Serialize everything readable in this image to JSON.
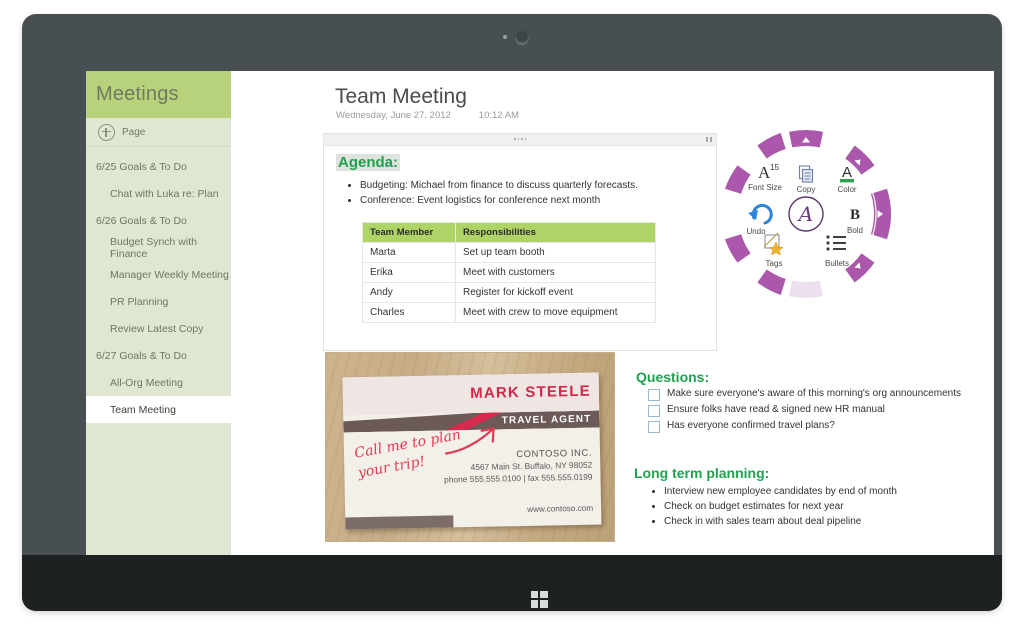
{
  "device": {
    "camera_icon": "camera-dot",
    "home_button_icon": "windows-logo-icon"
  },
  "sidebar": {
    "header_title": "Meetings",
    "new_page_label": "Page",
    "new_page_icon": "plus-circle-icon",
    "items": [
      {
        "label": "6/25 Goals & To Do",
        "level": 0,
        "selected": false
      },
      {
        "label": "Chat with Luka re: Plan",
        "level": 1,
        "selected": false
      },
      {
        "label": "6/26 Goals & To Do",
        "level": 0,
        "selected": false
      },
      {
        "label": "Budget Synch with Finance",
        "level": 1,
        "selected": false
      },
      {
        "label": "Manager Weekly Meeting",
        "level": 1,
        "selected": false
      },
      {
        "label": "PR Planning",
        "level": 1,
        "selected": false
      },
      {
        "label": "Review Latest Copy",
        "level": 1,
        "selected": false
      },
      {
        "label": "6/27 Goals & To Do",
        "level": 0,
        "selected": false
      },
      {
        "label": "All-Org Meeting",
        "level": 1,
        "selected": false
      },
      {
        "label": "Team Meeting",
        "level": 1,
        "selected": true
      }
    ]
  },
  "page": {
    "title": "Team Meeting",
    "date": "Wednesday, June 27, 2012",
    "time": "10:12 AM"
  },
  "agenda": {
    "heading": "Agenda:",
    "bullets": [
      "Budgeting:  Michael from finance to discuss quarterly forecasts.",
      "Conference: Event logistics for conference next month"
    ],
    "table": {
      "columns": [
        "Team Member",
        "Responsibilities"
      ],
      "rows": [
        [
          "Marta",
          "Set up team booth"
        ],
        [
          "Erika",
          "Meet with customers"
        ],
        [
          "Andy",
          "Register for kickoff event"
        ],
        [
          "Charles",
          "Meet with crew to move equipment"
        ]
      ]
    }
  },
  "radial_menu": {
    "center_label": "A",
    "center_icon": "onenote-a-icon",
    "ring_color": "#a855a8",
    "ring_color_light": "#ede2ef",
    "items": [
      {
        "label": "Copy",
        "icon": "copy-icon"
      },
      {
        "label": "Color",
        "icon": "font-color-icon"
      },
      {
        "label": "Bold",
        "icon": "bold-icon"
      },
      {
        "label": "Bullets",
        "icon": "bullets-icon"
      },
      {
        "label": "Tags",
        "icon": "tags-icon"
      },
      {
        "label": "Undo",
        "icon": "undo-icon"
      },
      {
        "label": "Font Size",
        "icon": "font-size-icon"
      }
    ],
    "font_size_value": "15"
  },
  "business_card": {
    "name": "MARK STEELE",
    "role": "TRAVEL AGENT",
    "company": "CONTOSO INC.",
    "address": "4567 Main St. Buffalo, NY 98052",
    "phone_fax": "phone 555.555.0100 | fax 555.555.0199",
    "website": "www.contoso.com",
    "handwriting": "Call me to plan your trip!"
  },
  "questions": {
    "heading": "Questions:",
    "items": [
      "Make sure everyone's aware of this morning's org announcements",
      "Ensure folks have read & signed new HR manual",
      "Has everyone confirmed travel plans?"
    ]
  },
  "long_term": {
    "heading": "Long term planning:",
    "items": [
      "Interview new employee candidates by end of month",
      "Check on budget estimates for next year",
      "Check in with sales team about deal pipeline"
    ]
  }
}
